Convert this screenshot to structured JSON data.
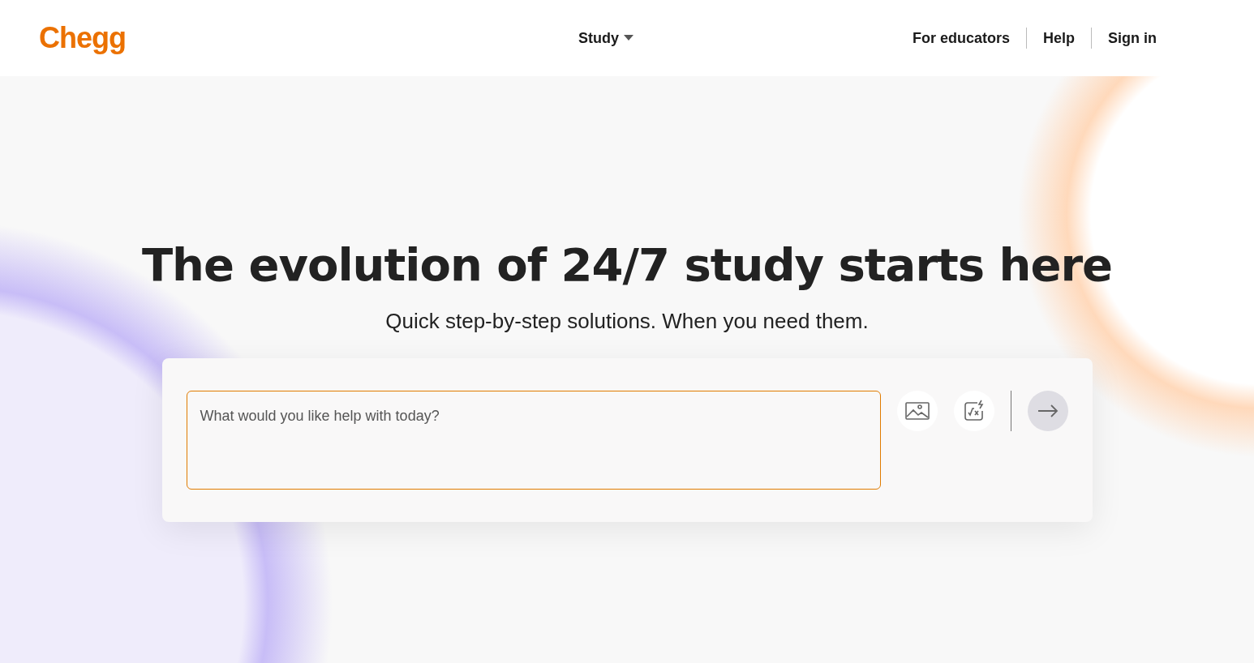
{
  "header": {
    "logo": "Chegg",
    "menu": {
      "label": "Study"
    },
    "links": [
      "For educators",
      "Help",
      "Sign in"
    ]
  },
  "hero": {
    "title": "The evolution of 24/7 study starts here",
    "subtitle": "Quick step-by-step solutions. When you need them.",
    "search": {
      "placeholder": "What would you like help with today?",
      "submit_disabled": true
    }
  }
}
